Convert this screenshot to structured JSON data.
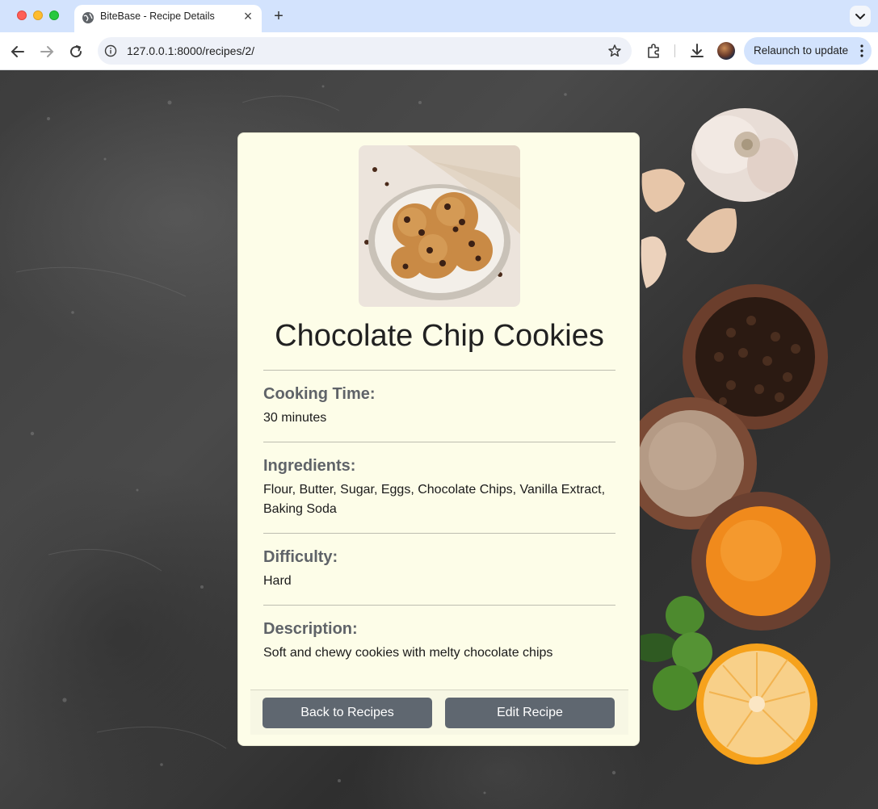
{
  "browser": {
    "tab_title": "BiteBase - Recipe Details",
    "url": "127.0.0.1:8000/recipes/2/",
    "relaunch_label": "Relaunch to update"
  },
  "recipe": {
    "title": "Chocolate Chip Cookies",
    "image_alt": "plate of chocolate chip cookies",
    "sections": [
      {
        "label": "Cooking Time:",
        "value": "30 minutes"
      },
      {
        "label": "Ingredients:",
        "value": "Flour, Butter, Sugar, Eggs, Chocolate Chips, Vanilla Extract, Baking Soda"
      },
      {
        "label": "Difficulty:",
        "value": "Hard"
      },
      {
        "label": "Description:",
        "value": "Soft and chewy cookies with melty chocolate chips"
      }
    ]
  },
  "actions": {
    "back_label": "Back to Recipes",
    "edit_label": "Edit Recipe"
  },
  "colors": {
    "card_background": "#fdfde8",
    "button_background": "#5f6770",
    "tabbar_background": "#d3e3fd"
  }
}
